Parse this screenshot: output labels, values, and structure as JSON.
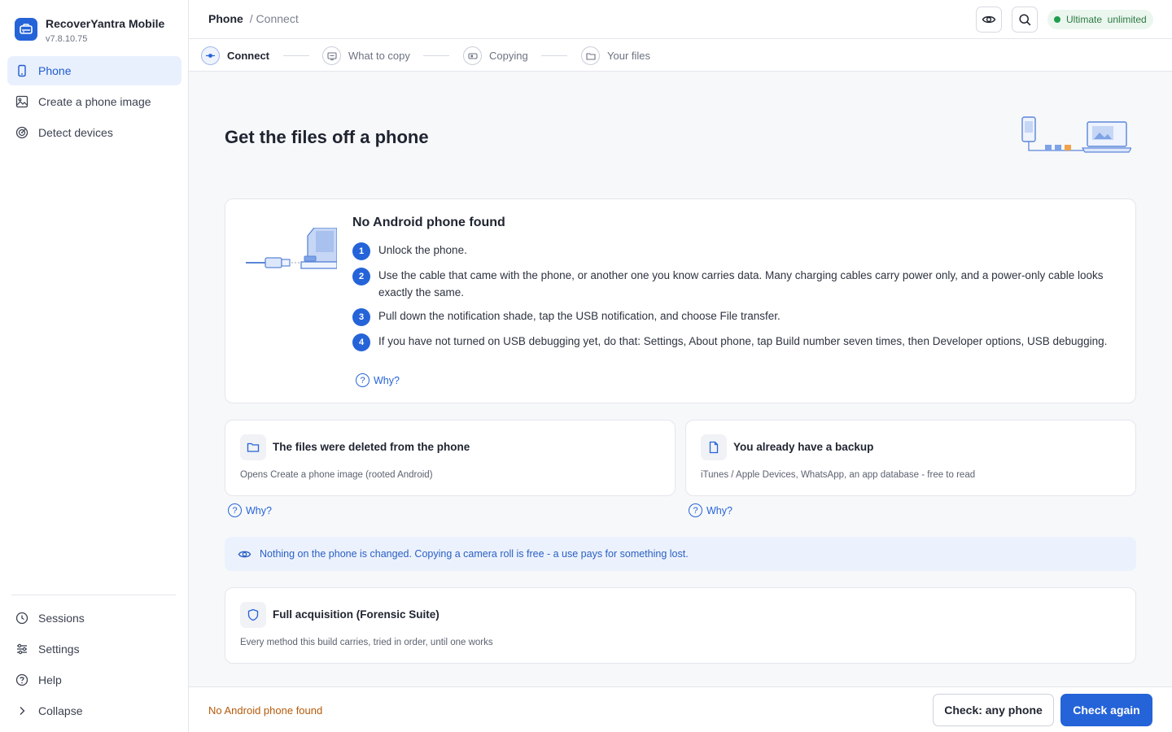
{
  "app": {
    "name": "RecoverYantra Mobile",
    "version": "v7.8.10.75"
  },
  "sidebar": {
    "items": [
      {
        "label": "Phone",
        "icon": "phone-icon",
        "active": true
      },
      {
        "label": "Create a phone image",
        "icon": "image-icon",
        "active": false
      },
      {
        "label": "Detect devices",
        "icon": "radar-icon",
        "active": false
      }
    ],
    "bottom": [
      {
        "label": "Sessions",
        "icon": "clock-icon"
      },
      {
        "label": "Settings",
        "icon": "sliders-icon"
      },
      {
        "label": "Help",
        "icon": "help-icon"
      },
      {
        "label": "Collapse",
        "icon": "chevron-right-icon"
      }
    ]
  },
  "header": {
    "breadcrumb_main": "Phone",
    "breadcrumb_sub": "/ Connect",
    "plan_badge": "Ultimate  unlimited",
    "accent": "#2563d8"
  },
  "stepper": [
    "Connect",
    "What to copy",
    "Copying",
    "Your files"
  ],
  "main": {
    "title": "Get the files off a phone",
    "status": {
      "title": "No Android phone found",
      "steps": [
        "Unlock the phone.",
        "Use the cable that came with the phone, or another one you know carries data. Many charging cables carry power only, and a power-only cable looks exactly the same.",
        "Pull down the notification shade, tap the USB notification, and choose File transfer.",
        "If you have not turned on USB debugging yet, do that: Settings, About phone, tap Build number seven times, then Developer options, USB debugging."
      ],
      "why": "Why?"
    },
    "options": [
      {
        "title": "The files were deleted from the phone",
        "subtitle": "Opens Create a phone image (rooted Android)",
        "why": "Why?",
        "icon": "folder-icon"
      },
      {
        "title": "You already have a backup",
        "subtitle": "iTunes / Apple Devices, WhatsApp, an app database - free to read",
        "why": "Why?",
        "icon": "file-icon"
      }
    ],
    "info": "Nothing on the phone is changed. Copying a camera roll is free - a use pays for something lost.",
    "forensic": {
      "title": "Full acquisition (Forensic Suite)",
      "subtitle": "Every method this build carries, tried in order, until one works",
      "icon": "shield-icon"
    }
  },
  "footer": {
    "status": "No Android phone found",
    "secondary_button": "Check: any phone",
    "primary_button": "Check again"
  }
}
